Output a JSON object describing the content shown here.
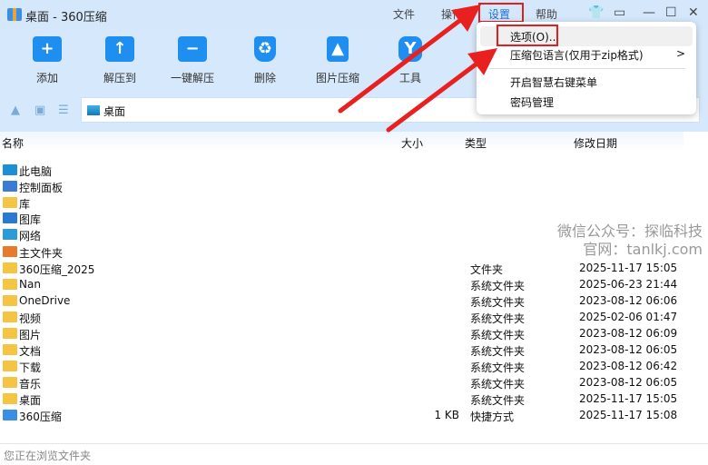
{
  "window": {
    "title": "桌面 - 360压缩"
  },
  "menubar": {
    "file": "文件",
    "action": "操作",
    "settings": "设置",
    "help": "帮助"
  },
  "toolbar": [
    {
      "label": "添加",
      "icon": "+"
    },
    {
      "label": "解压到",
      "icon": "↑"
    },
    {
      "label": "一键解压",
      "icon": "−"
    },
    {
      "label": "删除",
      "icon": "♻"
    },
    {
      "label": "图片压缩",
      "icon": "▲"
    },
    {
      "label": "工具",
      "icon": "Y"
    }
  ],
  "address": {
    "path": "桌面"
  },
  "columns": {
    "name": "名称",
    "size": "大小",
    "type": "类型",
    "date": "修改日期"
  },
  "rows": [
    {
      "name": "此电脑",
      "size": "",
      "type": "",
      "date": "",
      "icon": "computer"
    },
    {
      "name": "控制面板",
      "size": "",
      "type": "",
      "date": "",
      "icon": "control-panel"
    },
    {
      "name": "库",
      "size": "",
      "type": "",
      "date": "",
      "icon": "folder"
    },
    {
      "name": "图库",
      "size": "",
      "type": "",
      "date": "",
      "icon": "gallery"
    },
    {
      "name": "网络",
      "size": "",
      "type": "",
      "date": "",
      "icon": "network"
    },
    {
      "name": "主文件夹",
      "size": "",
      "type": "",
      "date": "",
      "icon": "home"
    },
    {
      "name": "360压缩_2025",
      "size": "",
      "type": "文件夹",
      "date": "2025-11-17 15:05",
      "icon": "folder"
    },
    {
      "name": "Nan",
      "size": "",
      "type": "系统文件夹",
      "date": "2025-06-23 21:44",
      "icon": "folder"
    },
    {
      "name": "OneDrive",
      "size": "",
      "type": "系统文件夹",
      "date": "2023-08-12 06:06",
      "icon": "folder"
    },
    {
      "name": "视频",
      "size": "",
      "type": "系统文件夹",
      "date": "2025-02-06 01:47",
      "icon": "folder"
    },
    {
      "name": "图片",
      "size": "",
      "type": "系统文件夹",
      "date": "2023-08-12 06:09",
      "icon": "folder"
    },
    {
      "name": "文档",
      "size": "",
      "type": "系统文件夹",
      "date": "2023-08-12 06:05",
      "icon": "folder"
    },
    {
      "name": "下载",
      "size": "",
      "type": "系统文件夹",
      "date": "2023-08-12 06:42",
      "icon": "folder"
    },
    {
      "name": "音乐",
      "size": "",
      "type": "系统文件夹",
      "date": "2023-08-12 06:05",
      "icon": "folder"
    },
    {
      "name": "桌面",
      "size": "",
      "type": "系统文件夹",
      "date": "2025-11-17 15:05",
      "icon": "folder"
    },
    {
      "name": "360压缩",
      "size": "1 KB",
      "type": "快捷方式",
      "date": "2025-11-17 15:08",
      "icon": "shortcut"
    }
  ],
  "settings_menu": {
    "options": "选项(O)...",
    "language": "压缩包语言(仅用于zip格式)",
    "smart_menu": "开启智慧右键菜单",
    "password": "密码管理",
    "submenu_arrow": ">"
  },
  "watermark": {
    "line1": "微信公众号：探临科技",
    "line2": "官网：tanlkj.com"
  },
  "status": {
    "text": "您正在浏览文件夹"
  },
  "colors": {
    "accent": "#1f8ef1",
    "highlight": "#e02020"
  }
}
